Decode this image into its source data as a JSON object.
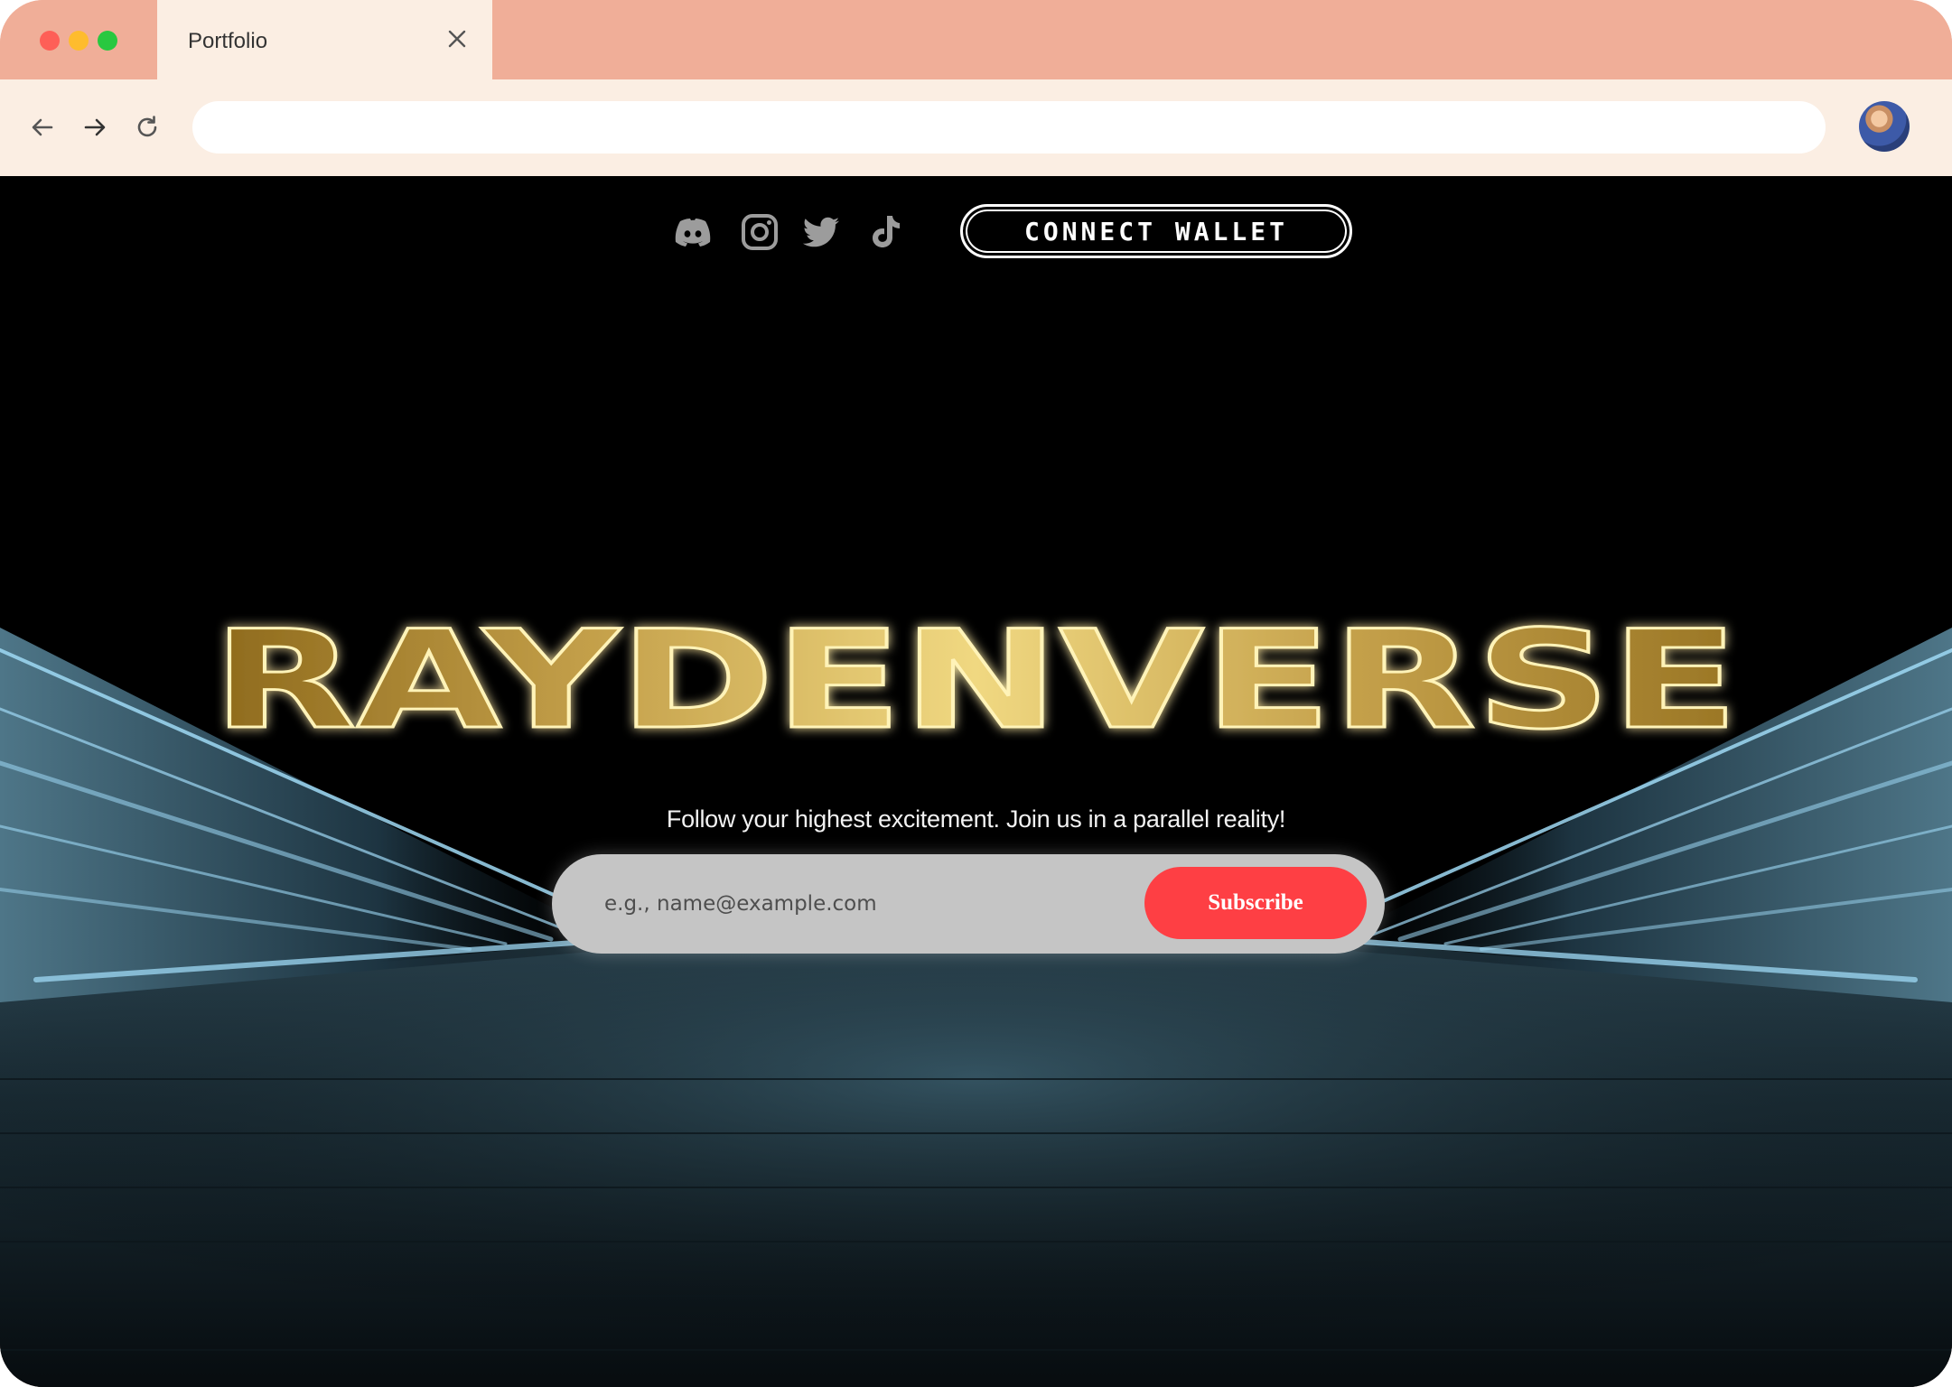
{
  "browser": {
    "tab": {
      "title": "Portfolio"
    },
    "address_bar": {
      "value": ""
    }
  },
  "nav": {
    "social_icons": [
      "discord-icon",
      "instagram-icon",
      "twitter-icon",
      "tiktok-icon"
    ],
    "connect_wallet_label": "CONNECT WALLET"
  },
  "hero": {
    "title": "RAYDENVERSE",
    "tagline": "Follow your highest excitement. Join us in a parallel reality!"
  },
  "subscribe": {
    "placeholder": "e.g., name@example.com",
    "button_label": "Subscribe"
  },
  "colors": {
    "tab_strip": "#f0ae98",
    "toolbar": "#fbeee3",
    "page_background": "#000000",
    "title_gold": "#d8b657",
    "subscribe_button": "#fe3f44",
    "form_background": "#c5c5c5",
    "light_streaks": "#9fd9f5"
  }
}
